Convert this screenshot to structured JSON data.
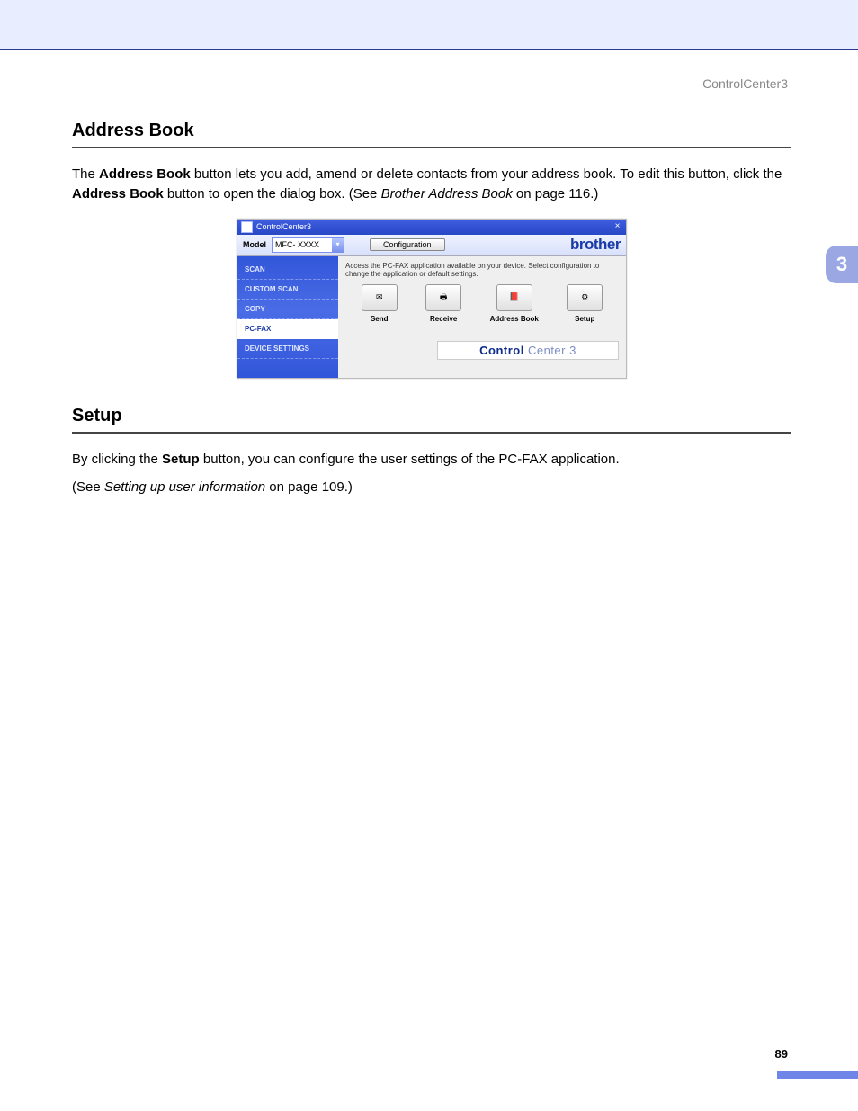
{
  "header": {
    "label": "ControlCenter3"
  },
  "chapter_tab": "3",
  "page_number": "89",
  "section1": {
    "title": "Address Book",
    "para_parts": {
      "t1": "The ",
      "b1": "Address Book",
      "t2": " button lets you add, amend or delete contacts from your address book. To edit this button, click the ",
      "b2": "Address Book",
      "t3": " button to open the dialog box. (See ",
      "i1": "Brother Address Book",
      "t4": " on page 116.)"
    }
  },
  "section2": {
    "title": "Setup",
    "p1": {
      "t1": "By clicking the ",
      "b1": "Setup",
      "t2": " button, you can configure the user settings of the PC-FAX application."
    },
    "p2": {
      "t1": "(See ",
      "i1": "Setting up user information",
      "t2": " on page 109.)"
    }
  },
  "shot": {
    "title": "ControlCenter3",
    "toolbar": {
      "model_label": "Model",
      "model_value": "MFC- XXXX",
      "config_label": "Configuration",
      "brand": "brother"
    },
    "sidebar": {
      "items": [
        {
          "label": "SCAN"
        },
        {
          "label": "CUSTOM SCAN"
        },
        {
          "label": "COPY"
        },
        {
          "label": "PC-FAX"
        },
        {
          "label": "DEVICE SETTINGS"
        }
      ],
      "active_index": 3
    },
    "desc": "Access the PC-FAX application available on your device. Select configuration to change the application or default settings.",
    "icons": [
      {
        "label": "Send",
        "glyph": "✉"
      },
      {
        "label": "Receive",
        "glyph": "🖶"
      },
      {
        "label": "Address Book",
        "glyph": "📕"
      },
      {
        "label": "Setup",
        "glyph": "⚙"
      }
    ],
    "logo": {
      "bold": "Control",
      "light": " Center 3"
    }
  }
}
